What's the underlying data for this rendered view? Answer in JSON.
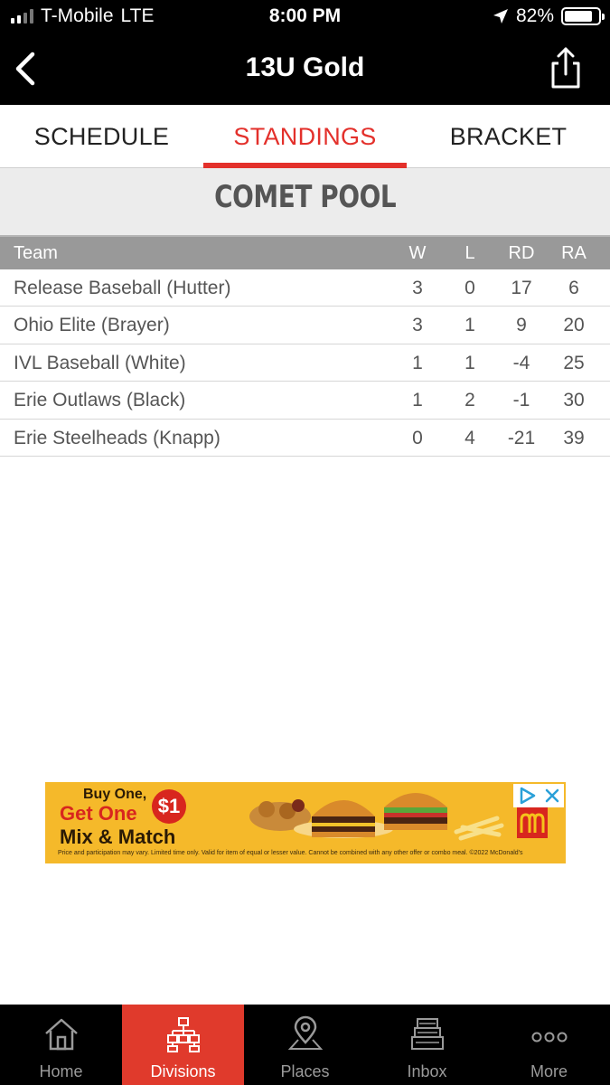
{
  "status_bar": {
    "carrier": "T-Mobile",
    "network": "LTE",
    "time": "8:00 PM",
    "battery_text": "82%",
    "battery_level": 0.82
  },
  "nav": {
    "title": "13U Gold"
  },
  "tabs": [
    {
      "label": "SCHEDULE",
      "active": false
    },
    {
      "label": "STANDINGS",
      "active": true
    },
    {
      "label": "BRACKET",
      "active": false
    }
  ],
  "pool": {
    "name": "COMET POOL"
  },
  "standings": {
    "headers": {
      "team": "Team",
      "w": "W",
      "l": "L",
      "rd": "RD",
      "ra": "RA"
    },
    "rows": [
      {
        "team": "Release Baseball (Hutter)",
        "w": "3",
        "l": "0",
        "rd": "17",
        "ra": "6"
      },
      {
        "team": "Ohio Elite (Brayer)",
        "w": "3",
        "l": "1",
        "rd": "9",
        "ra": "20"
      },
      {
        "team": "IVL Baseball (White)",
        "w": "1",
        "l": "1",
        "rd": "-4",
        "ra": "25"
      },
      {
        "team": "Erie Outlaws (Black)",
        "w": "1",
        "l": "2",
        "rd": "-1",
        "ra": "30"
      },
      {
        "team": "Erie Steelheads (Knapp)",
        "w": "0",
        "l": "4",
        "rd": "-21",
        "ra": "39"
      }
    ]
  },
  "ad": {
    "line1": "Buy One,",
    "line2": "Get One",
    "badge": "$1",
    "line3": "Mix & Match",
    "fine_print": "Price and participation may vary. Limited time only. Valid for item of equal or lesser value. Cannot be combined with any other offer or combo meal. ©2022 McDonald's"
  },
  "tabbar": {
    "items": [
      {
        "label": "Home",
        "icon": "home-icon",
        "active": false
      },
      {
        "label": "Divisions",
        "icon": "divisions-icon",
        "active": true
      },
      {
        "label": "Places",
        "icon": "map-pin-icon",
        "active": false
      },
      {
        "label": "Inbox",
        "icon": "inbox-icon",
        "active": false
      },
      {
        "label": "More",
        "icon": "more-icon",
        "active": false
      }
    ]
  },
  "colors": {
    "accent": "#e3302b",
    "tabbar_active": "#e03a2c",
    "header_gray": "#999999",
    "pool_bg": "#ececec"
  }
}
